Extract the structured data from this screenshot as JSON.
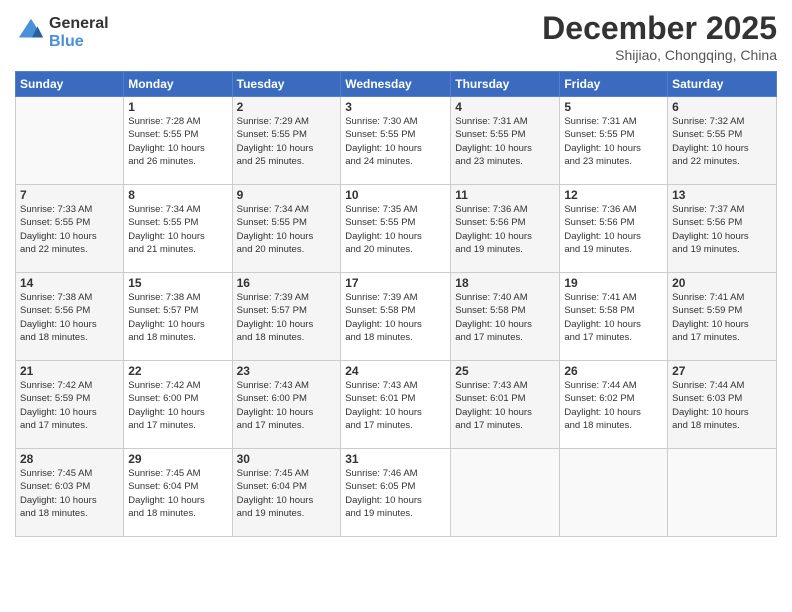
{
  "header": {
    "logo_line1": "General",
    "logo_line2": "Blue",
    "month": "December 2025",
    "location": "Shijiao, Chongqing, China"
  },
  "weekdays": [
    "Sunday",
    "Monday",
    "Tuesday",
    "Wednesday",
    "Thursday",
    "Friday",
    "Saturday"
  ],
  "weeks": [
    [
      {
        "day": "",
        "info": ""
      },
      {
        "day": "1",
        "info": "Sunrise: 7:28 AM\nSunset: 5:55 PM\nDaylight: 10 hours\nand 26 minutes."
      },
      {
        "day": "2",
        "info": "Sunrise: 7:29 AM\nSunset: 5:55 PM\nDaylight: 10 hours\nand 25 minutes."
      },
      {
        "day": "3",
        "info": "Sunrise: 7:30 AM\nSunset: 5:55 PM\nDaylight: 10 hours\nand 24 minutes."
      },
      {
        "day": "4",
        "info": "Sunrise: 7:31 AM\nSunset: 5:55 PM\nDaylight: 10 hours\nand 23 minutes."
      },
      {
        "day": "5",
        "info": "Sunrise: 7:31 AM\nSunset: 5:55 PM\nDaylight: 10 hours\nand 23 minutes."
      },
      {
        "day": "6",
        "info": "Sunrise: 7:32 AM\nSunset: 5:55 PM\nDaylight: 10 hours\nand 22 minutes."
      }
    ],
    [
      {
        "day": "7",
        "info": "Sunrise: 7:33 AM\nSunset: 5:55 PM\nDaylight: 10 hours\nand 22 minutes."
      },
      {
        "day": "8",
        "info": "Sunrise: 7:34 AM\nSunset: 5:55 PM\nDaylight: 10 hours\nand 21 minutes."
      },
      {
        "day": "9",
        "info": "Sunrise: 7:34 AM\nSunset: 5:55 PM\nDaylight: 10 hours\nand 20 minutes."
      },
      {
        "day": "10",
        "info": "Sunrise: 7:35 AM\nSunset: 5:55 PM\nDaylight: 10 hours\nand 20 minutes."
      },
      {
        "day": "11",
        "info": "Sunrise: 7:36 AM\nSunset: 5:56 PM\nDaylight: 10 hours\nand 19 minutes."
      },
      {
        "day": "12",
        "info": "Sunrise: 7:36 AM\nSunset: 5:56 PM\nDaylight: 10 hours\nand 19 minutes."
      },
      {
        "day": "13",
        "info": "Sunrise: 7:37 AM\nSunset: 5:56 PM\nDaylight: 10 hours\nand 19 minutes."
      }
    ],
    [
      {
        "day": "14",
        "info": "Sunrise: 7:38 AM\nSunset: 5:56 PM\nDaylight: 10 hours\nand 18 minutes."
      },
      {
        "day": "15",
        "info": "Sunrise: 7:38 AM\nSunset: 5:57 PM\nDaylight: 10 hours\nand 18 minutes."
      },
      {
        "day": "16",
        "info": "Sunrise: 7:39 AM\nSunset: 5:57 PM\nDaylight: 10 hours\nand 18 minutes."
      },
      {
        "day": "17",
        "info": "Sunrise: 7:39 AM\nSunset: 5:58 PM\nDaylight: 10 hours\nand 18 minutes."
      },
      {
        "day": "18",
        "info": "Sunrise: 7:40 AM\nSunset: 5:58 PM\nDaylight: 10 hours\nand 17 minutes."
      },
      {
        "day": "19",
        "info": "Sunrise: 7:41 AM\nSunset: 5:58 PM\nDaylight: 10 hours\nand 17 minutes."
      },
      {
        "day": "20",
        "info": "Sunrise: 7:41 AM\nSunset: 5:59 PM\nDaylight: 10 hours\nand 17 minutes."
      }
    ],
    [
      {
        "day": "21",
        "info": "Sunrise: 7:42 AM\nSunset: 5:59 PM\nDaylight: 10 hours\nand 17 minutes."
      },
      {
        "day": "22",
        "info": "Sunrise: 7:42 AM\nSunset: 6:00 PM\nDaylight: 10 hours\nand 17 minutes."
      },
      {
        "day": "23",
        "info": "Sunrise: 7:43 AM\nSunset: 6:00 PM\nDaylight: 10 hours\nand 17 minutes."
      },
      {
        "day": "24",
        "info": "Sunrise: 7:43 AM\nSunset: 6:01 PM\nDaylight: 10 hours\nand 17 minutes."
      },
      {
        "day": "25",
        "info": "Sunrise: 7:43 AM\nSunset: 6:01 PM\nDaylight: 10 hours\nand 17 minutes."
      },
      {
        "day": "26",
        "info": "Sunrise: 7:44 AM\nSunset: 6:02 PM\nDaylight: 10 hours\nand 18 minutes."
      },
      {
        "day": "27",
        "info": "Sunrise: 7:44 AM\nSunset: 6:03 PM\nDaylight: 10 hours\nand 18 minutes."
      }
    ],
    [
      {
        "day": "28",
        "info": "Sunrise: 7:45 AM\nSunset: 6:03 PM\nDaylight: 10 hours\nand 18 minutes."
      },
      {
        "day": "29",
        "info": "Sunrise: 7:45 AM\nSunset: 6:04 PM\nDaylight: 10 hours\nand 18 minutes."
      },
      {
        "day": "30",
        "info": "Sunrise: 7:45 AM\nSunset: 6:04 PM\nDaylight: 10 hours\nand 19 minutes."
      },
      {
        "day": "31",
        "info": "Sunrise: 7:46 AM\nSunset: 6:05 PM\nDaylight: 10 hours\nand 19 minutes."
      },
      {
        "day": "",
        "info": ""
      },
      {
        "day": "",
        "info": ""
      },
      {
        "day": "",
        "info": ""
      }
    ]
  ]
}
